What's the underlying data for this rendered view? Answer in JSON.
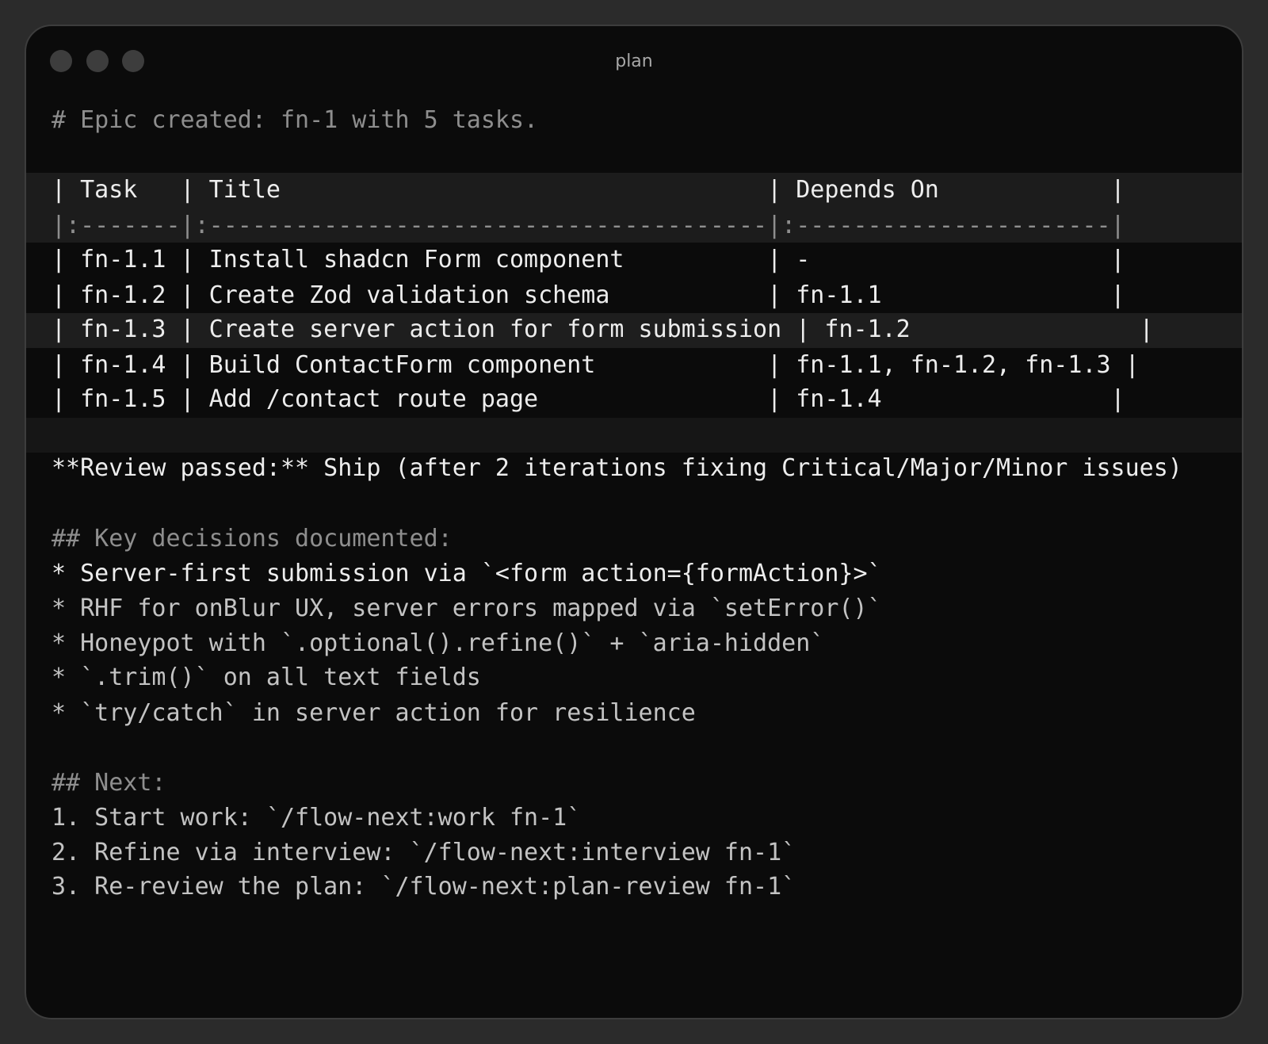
{
  "window": {
    "title": "plan"
  },
  "terminal": {
    "epic_line": "# Epic created: fn-1 with 5 tasks.",
    "table": {
      "header": "| Task   | Title                                  | Depends On            |",
      "separator": "|:-------|:---------------------------------------|:----------------------|",
      "rows": [
        "| fn-1.1 | Install shadcn Form component          | -                     |",
        "| fn-1.2 | Create Zod validation schema           | fn-1.1                |",
        "| fn-1.3 | Create server action for form submission | fn-1.2                |",
        "| fn-1.4 | Build ContactForm component            | fn-1.1, fn-1.2, fn-1.3 |",
        "| fn-1.5 | Add /contact route page                | fn-1.4                |"
      ]
    },
    "review_line": "**Review passed:** Ship (after 2 iterations fixing Critical/Major/Minor issues)",
    "decisions": {
      "heading": "## Key decisions documented:",
      "items": [
        "* Server-first submission via `<form action={formAction}>`",
        "* RHF for onBlur UX, server errors mapped via `setError()`",
        "* Honeypot with `.optional().refine()` + `aria-hidden`",
        "* `.trim()` on all text fields",
        "* `try/catch` in server action for resilience"
      ]
    },
    "next": {
      "heading": "## Next:",
      "items": [
        "1. Start work: `/flow-next:work fn-1`",
        "2. Refine via interview: `/flow-next:interview fn-1`",
        "3. Re-review the plan: `/flow-next:plan-review fn-1`"
      ]
    }
  },
  "colors": {
    "window_bg": "#0b0b0b",
    "page_bg": "#2b2b2b",
    "header_band": "#1c1c1c",
    "highlight_band": "#1e1e1e",
    "text_bright": "#ededed",
    "text_dim": "#8e8e8e"
  }
}
